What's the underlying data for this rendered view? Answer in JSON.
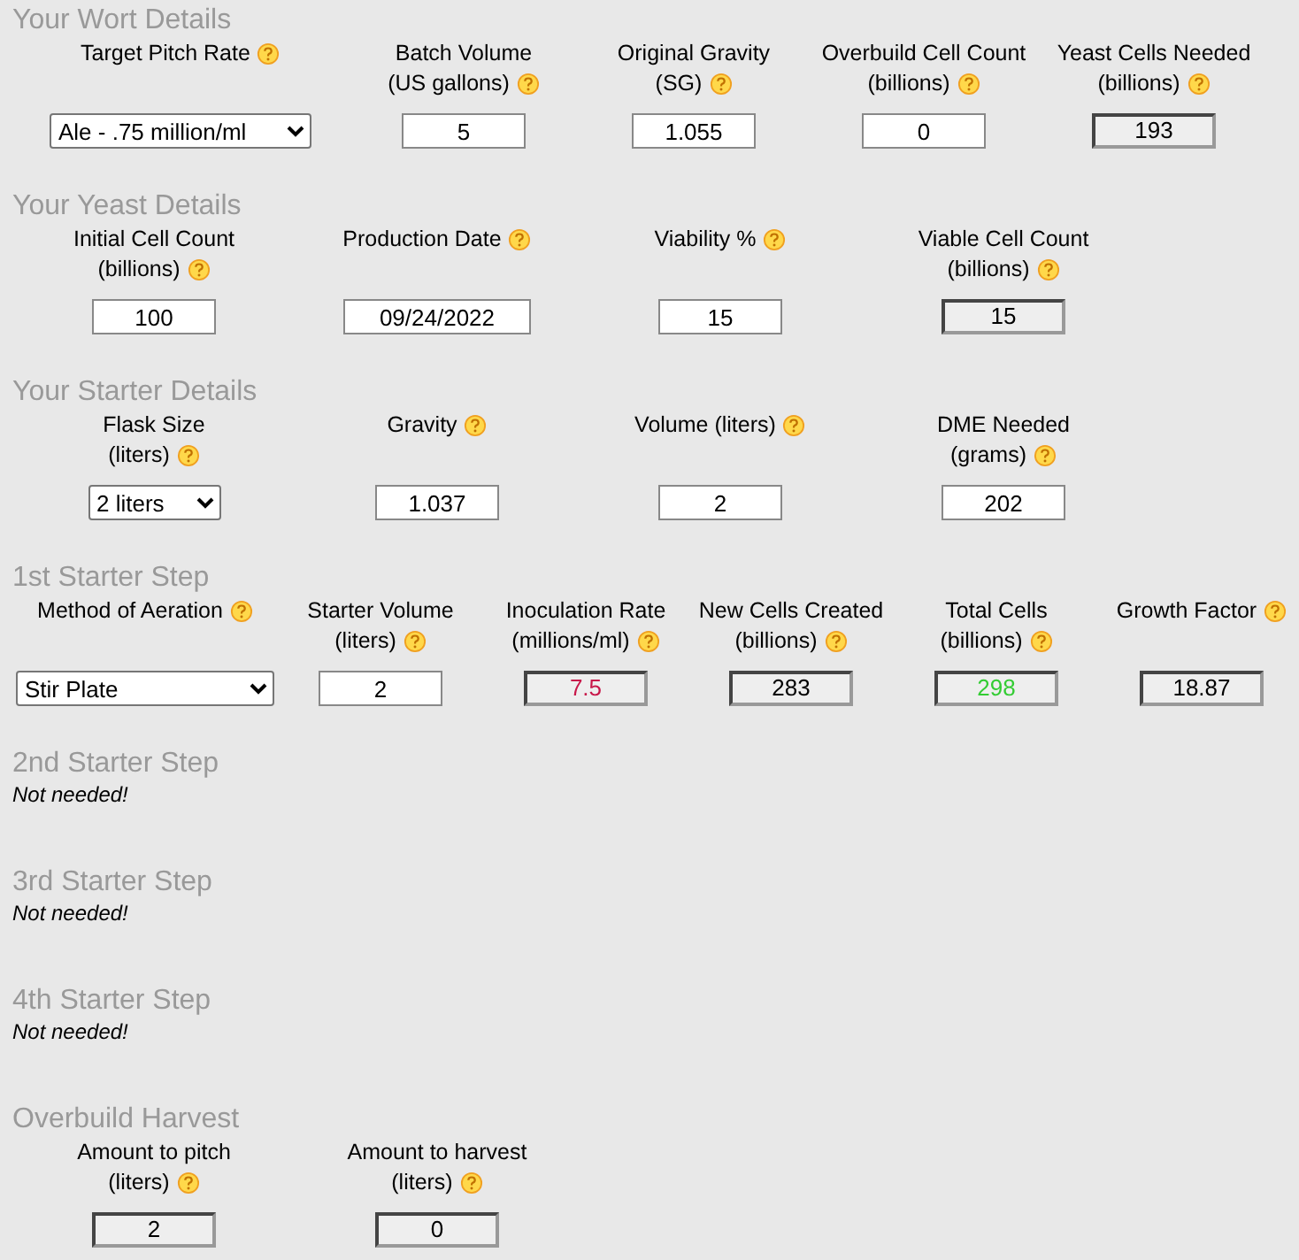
{
  "sections": [
    {
      "title": "Your Wort Details",
      "fields": [
        {
          "kind": "select",
          "label": [
            "Target Pitch Rate"
          ],
          "help": true,
          "value": "Ale - .75 million/ml"
        },
        {
          "kind": "input",
          "label": [
            "Batch Volume",
            "(US gallons)"
          ],
          "help": true,
          "value": "5"
        },
        {
          "kind": "input",
          "label": [
            "Original Gravity",
            "(SG)"
          ],
          "help": true,
          "value": "1.055"
        },
        {
          "kind": "input",
          "label": [
            "Overbuild Cell Count",
            "(billions)"
          ],
          "help": true,
          "value": "0"
        },
        {
          "kind": "output",
          "label": [
            "Yeast Cells Needed",
            "(billions)"
          ],
          "help": true,
          "value": "193"
        }
      ]
    },
    {
      "title": "Your Yeast Details",
      "fields": [
        {
          "kind": "input",
          "label": [
            "Initial Cell Count",
            "(billions)"
          ],
          "help": true,
          "value": "100"
        },
        {
          "kind": "input",
          "label": [
            "Production Date"
          ],
          "help": true,
          "value": "09/24/2022"
        },
        {
          "kind": "input",
          "label": [
            "Viability %"
          ],
          "help": true,
          "value": "15"
        },
        {
          "kind": "output",
          "label": [
            "Viable Cell Count",
            "(billions)"
          ],
          "help": true,
          "value": "15"
        }
      ]
    },
    {
      "title": "Your Starter Details",
      "fields": [
        {
          "kind": "select",
          "label": [
            "Flask Size",
            "(liters)"
          ],
          "help": true,
          "value": "2 liters"
        },
        {
          "kind": "input",
          "label": [
            "Gravity"
          ],
          "help": true,
          "value": "1.037"
        },
        {
          "kind": "input",
          "label": [
            "Volume (liters)"
          ],
          "help": true,
          "value": "2"
        },
        {
          "kind": "input",
          "label": [
            "DME Needed",
            "(grams)"
          ],
          "help": true,
          "value": "202"
        }
      ]
    },
    {
      "title": "1st Starter Step",
      "fields": [
        {
          "kind": "select",
          "label": [
            "Method of Aeration"
          ],
          "help": true,
          "value": "Stir Plate"
        },
        {
          "kind": "input",
          "label": [
            "Starter Volume",
            "(liters)"
          ],
          "help": true,
          "value": "2"
        },
        {
          "kind": "output",
          "label": [
            "Inoculation Rate",
            "(millions/ml)"
          ],
          "help": true,
          "value": "7.5",
          "color": "#c8184a"
        },
        {
          "kind": "output",
          "label": [
            "New Cells Created",
            "(billions)"
          ],
          "help": true,
          "value": "283"
        },
        {
          "kind": "output",
          "label": [
            "Total Cells",
            "(billions)"
          ],
          "help": true,
          "value": "298",
          "color": "#33cc33"
        },
        {
          "kind": "output",
          "label": [
            "Growth Factor"
          ],
          "help": true,
          "value": "18.87"
        }
      ]
    },
    {
      "title": "2nd Starter Step",
      "note": "Not needed!"
    },
    {
      "title": "3rd Starter Step",
      "note": "Not needed!"
    },
    {
      "title": "4th Starter Step",
      "note": "Not needed!"
    },
    {
      "title": "Overbuild Harvest",
      "fields": [
        {
          "kind": "output",
          "label": [
            "Amount to pitch",
            "(liters)"
          ],
          "help": true,
          "value": "2"
        },
        {
          "kind": "output",
          "label": [
            "Amount to harvest",
            "(liters)"
          ],
          "help": true,
          "value": "0"
        }
      ]
    }
  ]
}
